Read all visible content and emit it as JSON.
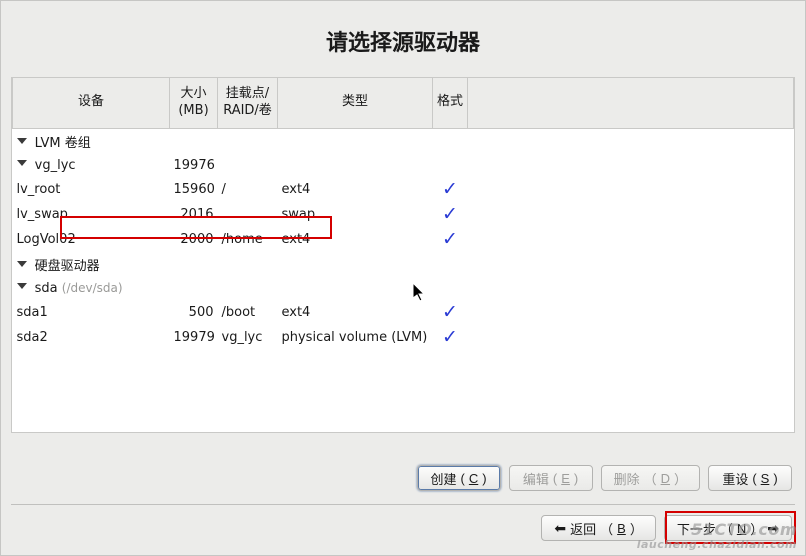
{
  "title": "请选择源驱动器",
  "columns": {
    "device": "设备",
    "size_line1": "大小",
    "size_line2": "(MB)",
    "mount_line1": "挂载点/",
    "mount_line2": "RAID/卷",
    "type": "类型",
    "format": "格式"
  },
  "groups": {
    "lvm": {
      "label": "LVM 卷组"
    },
    "disks": {
      "label": "硬盘驱动器"
    }
  },
  "vg": {
    "name": "vg_lyc",
    "size": "19976",
    "volumes": [
      {
        "name": "lv_root",
        "size": "15960",
        "mount": "/",
        "type": "ext4",
        "format": true
      },
      {
        "name": "lv_swap",
        "size": "2016",
        "mount": "",
        "type": "swap",
        "format": true
      },
      {
        "name": "LogVol02",
        "size": "2000",
        "mount": "/home",
        "type": "ext4",
        "format": true
      }
    ]
  },
  "disk": {
    "name": "sda",
    "path": "(/dev/sda)",
    "partitions": [
      {
        "name": "sda1",
        "size": "500",
        "mount": "/boot",
        "type": "ext4",
        "format": true
      },
      {
        "name": "sda2",
        "size": "19979",
        "mount": "vg_lyc",
        "type": "physical volume (LVM)",
        "format": true
      }
    ]
  },
  "buttons": {
    "create": "创建",
    "create_key": "C",
    "edit": "编辑",
    "edit_key": "E",
    "delete": "删除",
    "delete_key": "D",
    "reset": "重设",
    "reset_key": "S",
    "back": "返回",
    "back_key": "B",
    "next": "下一步",
    "next_key": "N"
  },
  "watermark": {
    "line1": "51CTO.com",
    "line2": "laucheng.chazidian.com"
  }
}
